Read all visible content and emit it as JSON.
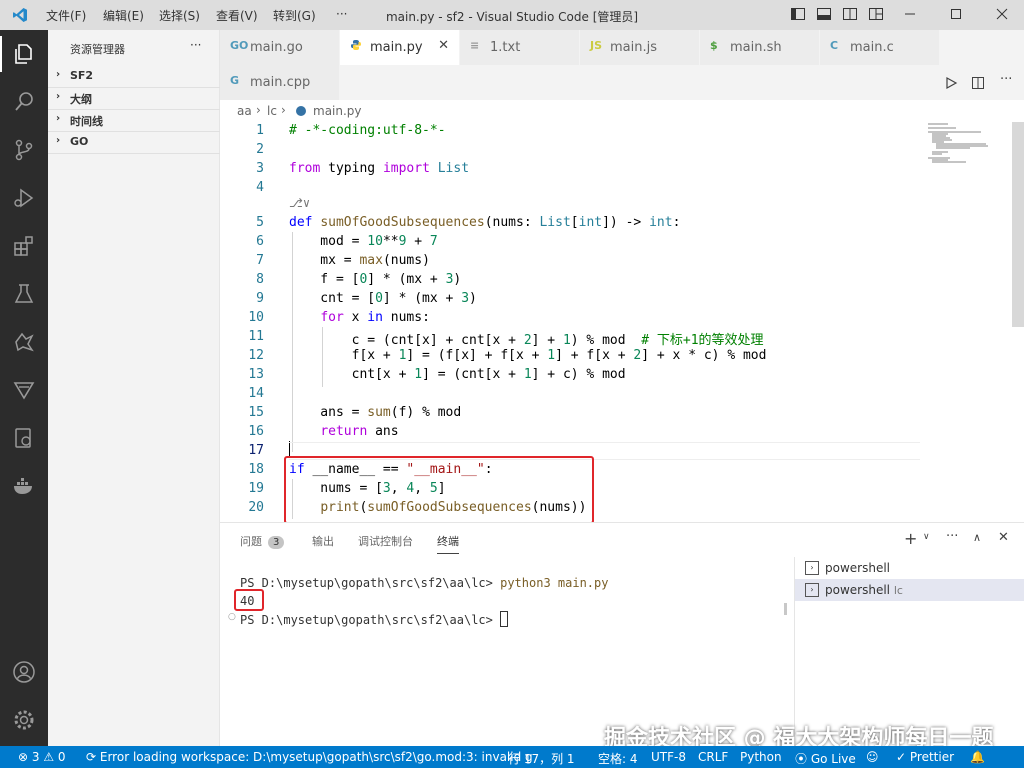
{
  "window": {
    "title": "main.py - sf2 - Visual Studio Code [管理员]",
    "menu": [
      "文件(F)",
      "编辑(E)",
      "选择(S)",
      "查看(V)",
      "转到(G)",
      "···"
    ]
  },
  "sidebar": {
    "title": "资源管理器",
    "more": "···",
    "sections": [
      "SF2",
      "大纲",
      "时间线",
      "GO"
    ]
  },
  "tabs": [
    {
      "label": "main.go",
      "icon": "go-icon",
      "icon_text": "GO",
      "active": false
    },
    {
      "label": "main.py",
      "icon": "python-icon",
      "icon_text": "",
      "active": true
    },
    {
      "label": "1.txt",
      "icon": "text-file-icon",
      "icon_text": "≡",
      "active": false
    },
    {
      "label": "main.js",
      "icon": "javascript-icon",
      "icon_text": "JS",
      "active": false
    },
    {
      "label": "main.sh",
      "icon": "shell-icon",
      "icon_text": "$",
      "active": false
    },
    {
      "label": "main.c",
      "icon": "c-icon",
      "icon_text": "C",
      "active": false
    },
    {
      "label": "main.cpp",
      "icon": "cpp-icon",
      "icon_text": "G",
      "active": false
    }
  ],
  "breadcrumb": [
    "aa",
    "lc",
    "main.py"
  ],
  "editor": {
    "line_numbers": [
      "1",
      "2",
      "3",
      "4",
      "",
      "5",
      "6",
      "7",
      "8",
      "9",
      "10",
      "11",
      "12",
      "13",
      "14",
      "15",
      "16",
      "17",
      "18",
      "19",
      "20"
    ],
    "codelens": "⎇∨",
    "cursor": "Ln 17"
  },
  "panel": {
    "tabs": [
      {
        "label": "问题",
        "badge": "3"
      },
      {
        "label": "输出",
        "badge": ""
      },
      {
        "label": "调试控制台",
        "badge": ""
      },
      {
        "label": "终端",
        "badge": ""
      }
    ],
    "terminal_lines": [
      {
        "prompt": "PS D:\\mysetup\\gopath\\src\\sf2\\aa\\lc> ",
        "cmd": "python3 main.py"
      },
      {
        "prompt": "40",
        "cmd": ""
      },
      {
        "prompt": "PS D:\\mysetup\\gopath\\src\\sf2\\aa\\lc> ",
        "cmd": ""
      }
    ],
    "terminals": [
      {
        "label": "powershell",
        "suffix": ""
      },
      {
        "label": "powershell",
        "suffix": "lc"
      }
    ]
  },
  "statusbar": {
    "errors": "3",
    "warnings": "0",
    "message": "Error loading workspace: D:\\mysetup\\gopath\\src\\sf2\\go.mod:3: invalid g",
    "position": "行 17，列 1",
    "indent": "空格: 4",
    "encoding": "UTF-8",
    "eol": "CRLF",
    "language": "Python",
    "golive": "Go Live",
    "prettier": "Prettier"
  },
  "watermark": "掘金技术社区 @ 福大大架构师每日一题",
  "colors": {
    "accent": "#007acc",
    "highlight_box": "#e0262b",
    "activity_bar": "#2c2c2c"
  }
}
